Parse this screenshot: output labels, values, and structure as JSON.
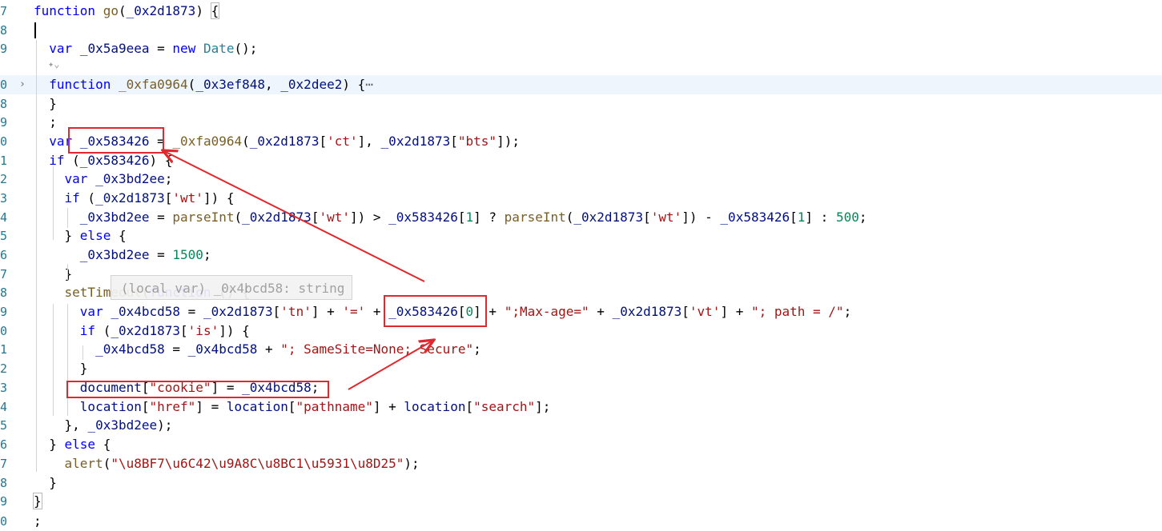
{
  "editor": {
    "lines": [
      {
        "gutter": "7",
        "segments": [
          [
            "k",
            "function"
          ],
          [
            "p",
            " "
          ],
          [
            "f",
            "go"
          ],
          [
            "p",
            "("
          ],
          [
            "v",
            "_0x2d1873"
          ],
          [
            "p",
            ") "
          ],
          [
            "brkt",
            "{"
          ]
        ]
      },
      {
        "gutter": "8",
        "segments": []
      },
      {
        "gutter": "9",
        "segments": [
          [
            "p",
            "  "
          ],
          [
            "k",
            "var"
          ],
          [
            "p",
            " "
          ],
          [
            "v",
            "_0x5a9eea"
          ],
          [
            "p",
            " = "
          ],
          [
            "k",
            "new"
          ],
          [
            "p",
            " "
          ],
          [
            "ty",
            "Date"
          ],
          [
            "p",
            "();"
          ]
        ]
      },
      {
        "gutter": "0",
        "fold": "›",
        "highlight": true,
        "segments": [
          [
            "p",
            "  "
          ],
          [
            "k",
            "function"
          ],
          [
            "p",
            " "
          ],
          [
            "f",
            "_0xfa0964"
          ],
          [
            "p",
            "("
          ],
          [
            "v",
            "_0x3ef848"
          ],
          [
            "p",
            ", "
          ],
          [
            "v",
            "_0x2dee2"
          ],
          [
            "p",
            ") "
          ],
          [
            "p",
            "{"
          ],
          [
            "fl",
            "⋯"
          ]
        ]
      },
      {
        "gutter": "8",
        "segments": [
          [
            "p",
            "  }"
          ]
        ]
      },
      {
        "gutter": "9",
        "segments": [
          [
            "p",
            "  ;"
          ]
        ]
      },
      {
        "gutter": "0",
        "segments": [
          [
            "p",
            "  "
          ],
          [
            "k",
            "var"
          ],
          [
            "p",
            " "
          ],
          [
            "v",
            "_0x583426"
          ],
          [
            "p",
            " = "
          ],
          [
            "f",
            "_0xfa0964"
          ],
          [
            "p",
            "("
          ],
          [
            "v",
            "_0x2d1873"
          ],
          [
            "p",
            "["
          ],
          [
            "s",
            "'ct'"
          ],
          [
            "p",
            "], "
          ],
          [
            "v",
            "_0x2d1873"
          ],
          [
            "p",
            "["
          ],
          [
            "s",
            "\"bts\""
          ],
          [
            "p",
            "]);"
          ]
        ]
      },
      {
        "gutter": "1",
        "segments": [
          [
            "p",
            "  "
          ],
          [
            "k",
            "if"
          ],
          [
            "p",
            " ("
          ],
          [
            "v",
            "_0x583426"
          ],
          [
            "p",
            ") {"
          ]
        ]
      },
      {
        "gutter": "2",
        "segments": [
          [
            "p",
            "    "
          ],
          [
            "k",
            "var"
          ],
          [
            "p",
            " "
          ],
          [
            "v",
            "_0x3bd2ee"
          ],
          [
            "p",
            ";"
          ]
        ]
      },
      {
        "gutter": "3",
        "segments": [
          [
            "p",
            "    "
          ],
          [
            "k",
            "if"
          ],
          [
            "p",
            " ("
          ],
          [
            "v",
            "_0x2d1873"
          ],
          [
            "p",
            "["
          ],
          [
            "s",
            "'wt'"
          ],
          [
            "p",
            "]) {"
          ]
        ]
      },
      {
        "gutter": "4",
        "segments": [
          [
            "p",
            "      "
          ],
          [
            "v",
            "_0x3bd2ee"
          ],
          [
            "p",
            " = "
          ],
          [
            "f",
            "parseInt"
          ],
          [
            "p",
            "("
          ],
          [
            "v",
            "_0x2d1873"
          ],
          [
            "p",
            "["
          ],
          [
            "s",
            "'wt'"
          ],
          [
            "p",
            "]) > "
          ],
          [
            "v",
            "_0x583426"
          ],
          [
            "p",
            "["
          ],
          [
            "n",
            "1"
          ],
          [
            "p",
            "] ? "
          ],
          [
            "f",
            "parseInt"
          ],
          [
            "p",
            "("
          ],
          [
            "v",
            "_0x2d1873"
          ],
          [
            "p",
            "["
          ],
          [
            "s",
            "'wt'"
          ],
          [
            "p",
            "]) - "
          ],
          [
            "v",
            "_0x583426"
          ],
          [
            "p",
            "["
          ],
          [
            "n",
            "1"
          ],
          [
            "p",
            "] : "
          ],
          [
            "n",
            "500"
          ],
          [
            "p",
            ";"
          ]
        ]
      },
      {
        "gutter": "5",
        "segments": [
          [
            "p",
            "    } "
          ],
          [
            "k",
            "else"
          ],
          [
            "p",
            " {"
          ]
        ]
      },
      {
        "gutter": "6",
        "segments": [
          [
            "p",
            "      "
          ],
          [
            "v",
            "_0x3bd2ee"
          ],
          [
            "p",
            " = "
          ],
          [
            "n",
            "1500"
          ],
          [
            "p",
            ";"
          ]
        ]
      },
      {
        "gutter": "7",
        "segments": [
          [
            "p",
            "    }"
          ]
        ]
      },
      {
        "gutter": "8",
        "segments": [
          [
            "p",
            "    "
          ],
          [
            "f",
            "setTimeout"
          ],
          [
            "p",
            "("
          ],
          [
            "k",
            "function"
          ],
          [
            "p",
            " () {"
          ]
        ]
      },
      {
        "gutter": "9",
        "segments": [
          [
            "p",
            "      "
          ],
          [
            "k",
            "var"
          ],
          [
            "p",
            " "
          ],
          [
            "v",
            "_0x4bcd58"
          ],
          [
            "p",
            " = "
          ],
          [
            "v",
            "_0x2d1873"
          ],
          [
            "p",
            "["
          ],
          [
            "s",
            "'tn'"
          ],
          [
            "p",
            "] + "
          ],
          [
            "s",
            "'='"
          ],
          [
            "p",
            " + "
          ],
          [
            "v",
            "_0x583426"
          ],
          [
            "p",
            "["
          ],
          [
            "n",
            "0"
          ],
          [
            "p",
            "] + "
          ],
          [
            "s",
            "\";Max-age=\""
          ],
          [
            "p",
            " + "
          ],
          [
            "v",
            "_0x2d1873"
          ],
          [
            "p",
            "["
          ],
          [
            "s",
            "'vt'"
          ],
          [
            "p",
            "] + "
          ],
          [
            "s",
            "\"; path = /\""
          ],
          [
            "p",
            ";"
          ]
        ]
      },
      {
        "gutter": "0",
        "segments": [
          [
            "p",
            "      "
          ],
          [
            "k",
            "if"
          ],
          [
            "p",
            " ("
          ],
          [
            "v",
            "_0x2d1873"
          ],
          [
            "p",
            "["
          ],
          [
            "s",
            "'is'"
          ],
          [
            "p",
            "]) {"
          ]
        ]
      },
      {
        "gutter": "1",
        "segments": [
          [
            "p",
            "        "
          ],
          [
            "v",
            "_0x4bcd58"
          ],
          [
            "p",
            " = "
          ],
          [
            "v",
            "_0x4bcd58"
          ],
          [
            "p",
            " + "
          ],
          [
            "s",
            "\"; SameSite=None; Secure\""
          ],
          [
            "p",
            ";"
          ]
        ]
      },
      {
        "gutter": "2",
        "segments": [
          [
            "p",
            "      }"
          ]
        ]
      },
      {
        "gutter": "3",
        "segments": [
          [
            "p",
            "      "
          ],
          [
            "v",
            "document"
          ],
          [
            "p",
            "["
          ],
          [
            "s",
            "\"cookie\""
          ],
          [
            "p",
            "] = "
          ],
          [
            "v",
            "_0x4bcd58"
          ],
          [
            "p",
            ";"
          ]
        ]
      },
      {
        "gutter": "4",
        "segments": [
          [
            "p",
            "      "
          ],
          [
            "v",
            "location"
          ],
          [
            "p",
            "["
          ],
          [
            "s",
            "\"href\""
          ],
          [
            "p",
            "] = "
          ],
          [
            "v",
            "location"
          ],
          [
            "p",
            "["
          ],
          [
            "s",
            "\"pathname\""
          ],
          [
            "p",
            "] + "
          ],
          [
            "v",
            "location"
          ],
          [
            "p",
            "["
          ],
          [
            "s",
            "\"search\""
          ],
          [
            "p",
            "];"
          ]
        ]
      },
      {
        "gutter": "5",
        "segments": [
          [
            "p",
            "    }, "
          ],
          [
            "v",
            "_0x3bd2ee"
          ],
          [
            "p",
            ");"
          ]
        ]
      },
      {
        "gutter": "6",
        "segments": [
          [
            "p",
            "  } "
          ],
          [
            "k",
            "else"
          ],
          [
            "p",
            " {"
          ]
        ]
      },
      {
        "gutter": "7",
        "segments": [
          [
            "p",
            "    "
          ],
          [
            "f",
            "alert"
          ],
          [
            "p",
            "("
          ],
          [
            "s",
            "\"\\u8BF7\\u6C42\\u9A8C\\u8BC1\\u5931\\u8D25\""
          ],
          [
            "p",
            ");"
          ]
        ]
      },
      {
        "gutter": "8",
        "segments": [
          [
            "p",
            "  }"
          ]
        ]
      },
      {
        "gutter": "9",
        "segments": [
          [
            "brkt",
            "}"
          ]
        ]
      },
      {
        "gutter": "0",
        "segments": [
          [
            "p",
            ";"
          ]
        ]
      }
    ],
    "hover_hint": "(local var) _0x4bcd58: string",
    "inlay_icon": "sparkle-icon"
  },
  "annotation_color": "#e0282e"
}
